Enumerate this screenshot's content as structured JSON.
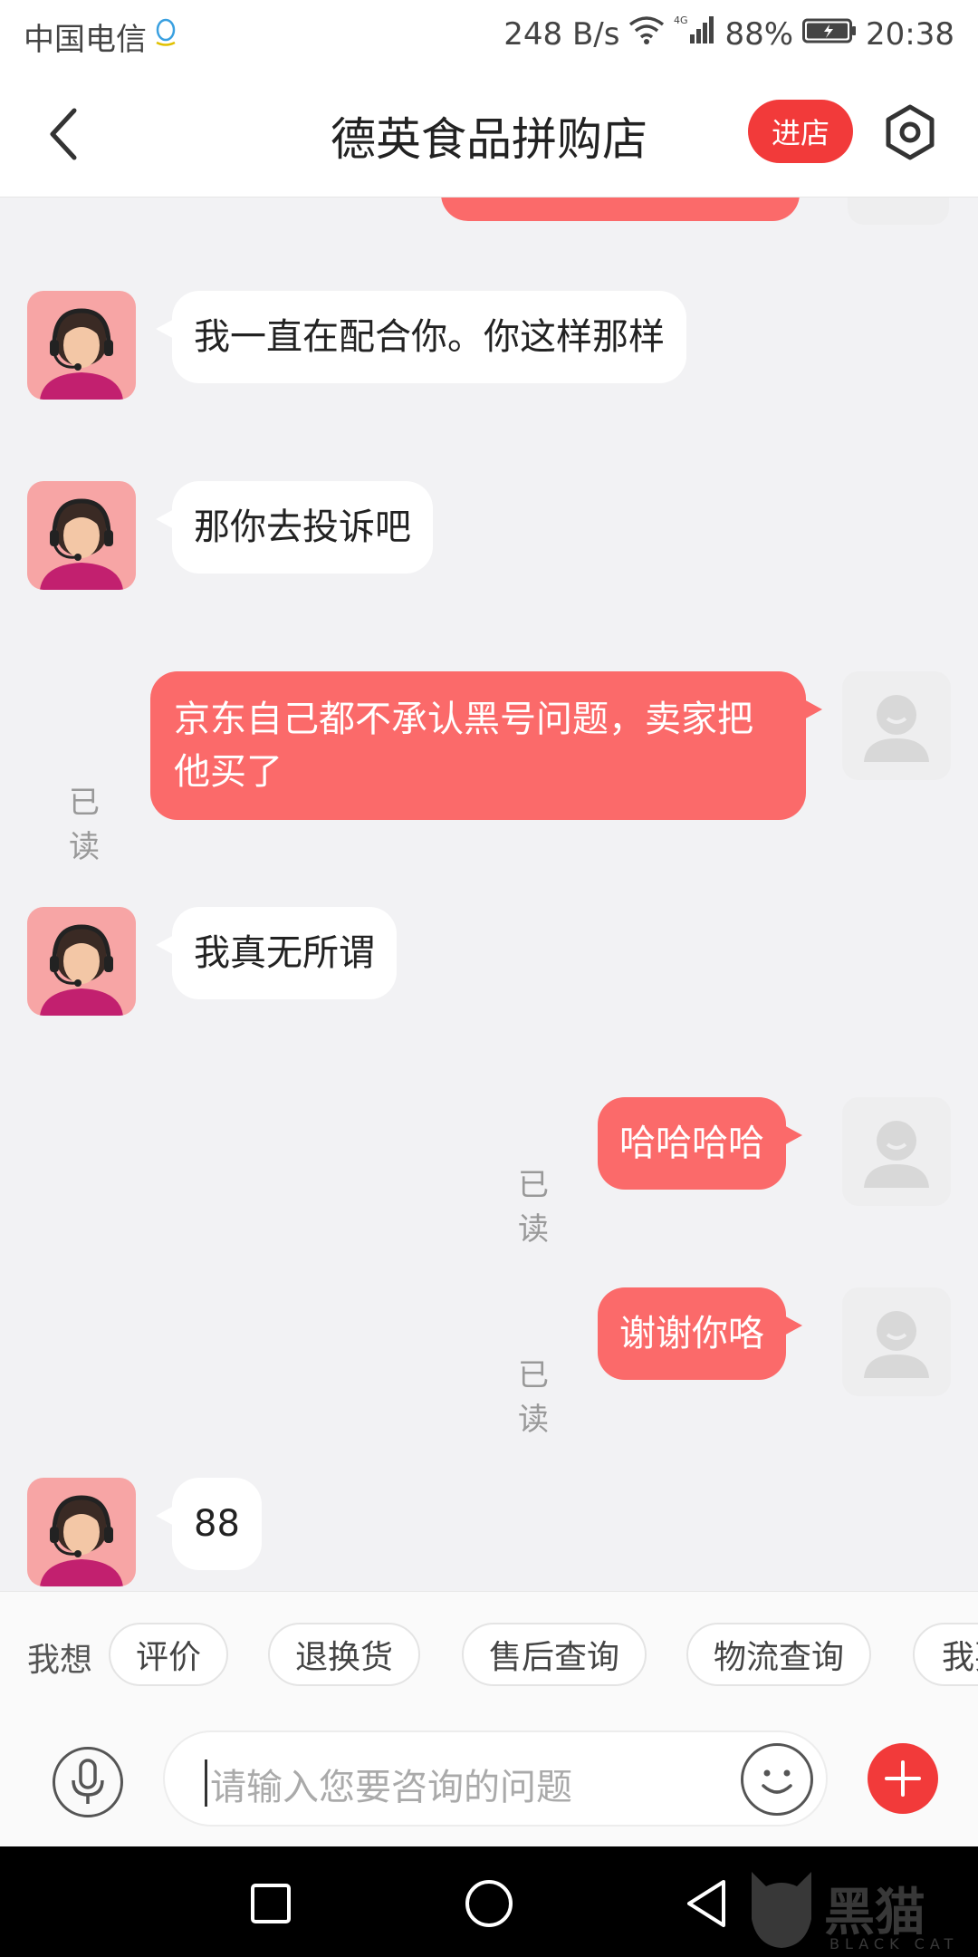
{
  "status_bar": {
    "carrier": "中国电信",
    "net_speed": "248 B/s",
    "network_type": "4G",
    "battery": "88%",
    "time": "20:38"
  },
  "header": {
    "title": "德英食品拼购店",
    "shop_button": "进店"
  },
  "messages": [
    {
      "from": "agent",
      "text": "我一直在配合你。你这样那样"
    },
    {
      "from": "agent",
      "text": "那你去投诉吧"
    },
    {
      "from": "user",
      "text": "京东自己都不承认黑号问题，卖家把他买了",
      "status": "已读"
    },
    {
      "from": "agent",
      "text": "我真无所谓"
    },
    {
      "from": "user",
      "text": "哈哈哈哈",
      "status": "已读"
    },
    {
      "from": "user",
      "text": "谢谢你咯",
      "status": "已读"
    },
    {
      "from": "agent",
      "text": "88"
    }
  ],
  "quick_options": {
    "label": "我想",
    "items": [
      "评价",
      "退换货",
      "售后查询",
      "物流查询",
      "我要"
    ]
  },
  "input": {
    "placeholder": "请输入您要咨询的问题"
  },
  "watermark": {
    "text": "黑猫",
    "sub": "BLACK CAT"
  },
  "colors": {
    "accent": "#f23a3a",
    "outgoing_bubble": "#fb6a6a",
    "chat_background": "#f2f2f4"
  }
}
